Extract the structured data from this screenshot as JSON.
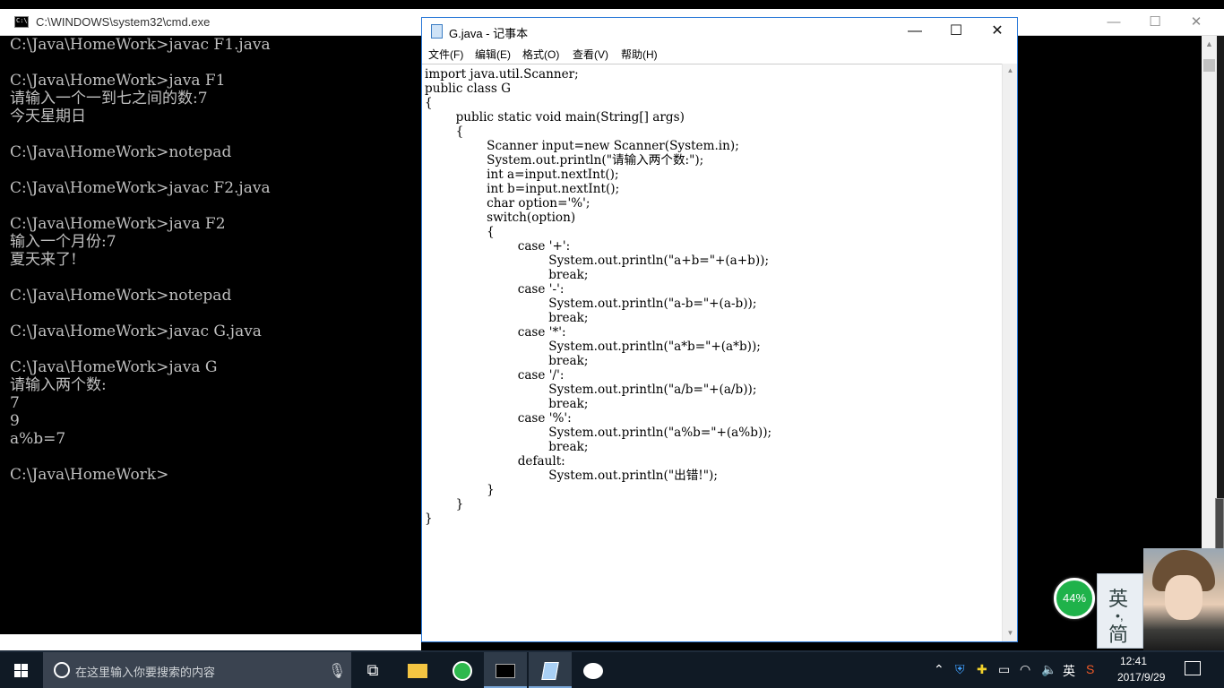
{
  "cmd": {
    "title": "C:\\WINDOWS\\system32\\cmd.exe",
    "lines": [
      "C:\\Java\\HomeWork>javac F1.java",
      "",
      "C:\\Java\\HomeWork>java F1",
      "请输入一个一到七之间的数:7",
      "今天星期日",
      "",
      "C:\\Java\\HomeWork>notepad",
      "",
      "C:\\Java\\HomeWork>javac F2.java",
      "",
      "C:\\Java\\HomeWork>java F2",
      "输入一个月份:7",
      "夏天来了!",
      "",
      "C:\\Java\\HomeWork>notepad",
      "",
      "C:\\Java\\HomeWork>javac G.java",
      "",
      "C:\\Java\\HomeWork>java G",
      "请输入两个数:",
      "7",
      "9",
      "a%b=7",
      "",
      "C:\\Java\\HomeWork>"
    ],
    "controls": {
      "minimize": "—",
      "maximize": "☐",
      "close": "✕"
    }
  },
  "notepad": {
    "title": "G.java - 记事本",
    "menu": [
      "文件(F)",
      "编辑(E)",
      "格式(O)",
      "查看(V)",
      "帮助(H)"
    ],
    "controls": {
      "minimize": "—",
      "maximize": "☐",
      "close": "✕"
    },
    "code": [
      "import java.util.Scanner;",
      "public class G",
      "{",
      "        public static void main(String[] args)",
      "        {",
      "                Scanner input=new Scanner(System.in);",
      "                System.out.println(\"请输入两个数:\");",
      "                int a=input.nextInt();",
      "                int b=input.nextInt();",
      "                char option='%';",
      "                switch(option)",
      "                {",
      "                        case '+':",
      "                                System.out.println(\"a+b=\"+(a+b));",
      "                                break;",
      "                        case '-':",
      "                                System.out.println(\"a-b=\"+(a-b));",
      "                                break;",
      "                        case '*':",
      "                                System.out.println(\"a*b=\"+(a*b));",
      "                                break;",
      "                        case '/':",
      "                                System.out.println(\"a/b=\"+(a/b));",
      "                                break;",
      "                        case '%':",
      "                                System.out.println(\"a%b=\"+(a%b));",
      "                                break;",
      "                        default:",
      "                                System.out.println(\"出错!\");",
      "                }",
      "        }",
      "}"
    ]
  },
  "widgets": {
    "speed_percent": "44%",
    "ime_mode_en": "英",
    "ime_dot": "•,",
    "ime_mode_simplified": "简"
  },
  "taskbar": {
    "search_placeholder": "在这里输入你要搜索的内容",
    "apps": [
      {
        "icon": "task-view-icon"
      },
      {
        "icon": "file-explorer-icon"
      },
      {
        "icon": "browser-360-icon"
      },
      {
        "icon": "cmd-icon"
      },
      {
        "icon": "notepad-icon"
      },
      {
        "icon": "wechat-icon"
      }
    ],
    "tray": {
      "input_lang": "英",
      "time": "12:41",
      "date": "2017/9/29"
    }
  },
  "colors": {
    "cmd_bg": "#000000",
    "cmd_text": "#c0c0c0",
    "taskbar_bg": "#101a25",
    "notepad_border": "#2b79d8",
    "speed_ball": "#1fb24a"
  }
}
